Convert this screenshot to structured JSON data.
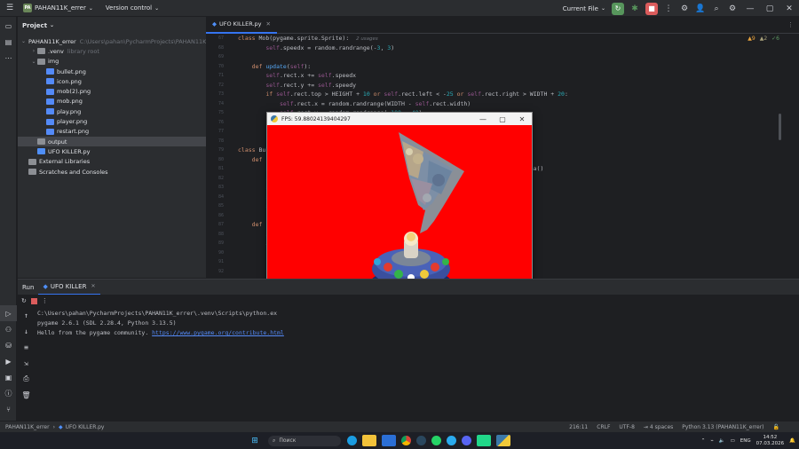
{
  "titlebar": {
    "menu_icon": "hamburger-icon",
    "project_badge": "PA",
    "project_name": "PAHAN11K_errer",
    "vcs_label": "Version control",
    "run_config": "Current File",
    "colors": {
      "run_green": "#57965c",
      "stop_red": "#db5c5c"
    }
  },
  "project_panel": {
    "title": "Project",
    "tree": [
      {
        "label": "PAHAN11K_errer",
        "hint": "C:\\Users\\pahan\\PycharmProjects\\PAHAN11K_errer",
        "level": 0,
        "icon": "folder-icon",
        "expanded": true
      },
      {
        "label": ".venv",
        "hint": "library root",
        "level": 1,
        "icon": "folder-icon",
        "expanded": false
      },
      {
        "label": "img",
        "hint": "",
        "level": 1,
        "icon": "folder-icon",
        "expanded": true
      },
      {
        "label": "bullet.png",
        "hint": "",
        "level": 2,
        "icon": "image-file-icon"
      },
      {
        "label": "icon.png",
        "hint": "",
        "level": 2,
        "icon": "image-file-icon"
      },
      {
        "label": "mob(2).png",
        "hint": "",
        "level": 2,
        "icon": "image-file-icon"
      },
      {
        "label": "mob.png",
        "hint": "",
        "level": 2,
        "icon": "image-file-icon"
      },
      {
        "label": "play.png",
        "hint": "",
        "level": 2,
        "icon": "image-file-icon"
      },
      {
        "label": "player.png",
        "hint": "",
        "level": 2,
        "icon": "image-file-icon"
      },
      {
        "label": "restart.png",
        "hint": "",
        "level": 2,
        "icon": "image-file-icon"
      },
      {
        "label": "output",
        "hint": "",
        "level": 1,
        "icon": "folder-icon",
        "selected": true
      },
      {
        "label": "UFO KILLER.py",
        "hint": "",
        "level": 1,
        "icon": "python-file-icon"
      },
      {
        "label": "External Libraries",
        "hint": "",
        "level": 0,
        "icon": "library-icon"
      },
      {
        "label": "Scratches and Consoles",
        "hint": "",
        "level": 0,
        "icon": "scratches-icon"
      }
    ]
  },
  "editor": {
    "tab_label": "UFO KILLER.py",
    "inspections": {
      "warnings": "9",
      "weak_warnings": "2",
      "typos": "6"
    },
    "lines": [
      {
        "n": "67",
        "html": "<span class='kw'>class</span> Mob(pygame.sprite.Sprite):  <span class='hint'>2 usages</span>"
      },
      {
        "n": "68",
        "html": "        <span class='sf'>self</span>.speedx = random.randrange(-<span class='num'>3</span>, <span class='num'>3</span>)"
      },
      {
        "n": "69",
        "html": ""
      },
      {
        "n": "70",
        "html": "    <span class='kw'>def</span> <span class='fn'>update</span>(<span class='sf'>self</span>):"
      },
      {
        "n": "71",
        "html": "        <span class='sf'>self</span>.rect.x += <span class='sf'>self</span>.speedx"
      },
      {
        "n": "72",
        "html": "        <span class='sf'>self</span>.rect.y += <span class='sf'>self</span>.speedy"
      },
      {
        "n": "73",
        "html": "        <span class='kw'>if</span> <span class='sf'>self</span>.rect.top &gt; HEIGHT + <span class='num'>10</span> <span class='kw'>or</span> <span class='sf'>self</span>.rect.left &lt; -<span class='num'>25</span> <span class='kw'>or</span> <span class='sf'>self</span>.rect.right &gt; WIDTH + <span class='num'>20</span>:"
      },
      {
        "n": "74",
        "html": "            <span class='sf'>self</span>.rect.x = random.randrange(WIDTH - <span class='sf'>self</span>.rect.width)"
      },
      {
        "n": "75",
        "html": "            <span class='sf'>self</span>.rect.y = random.randrange(-<span class='num'>100</span>, -<span class='num'>40</span>)"
      },
      {
        "n": "76",
        "html": ""
      },
      {
        "n": "77",
        "html": ""
      },
      {
        "n": "78",
        "html": ""
      },
      {
        "n": "79",
        "html": "<span class='kw'>class</span> Bul"
      },
      {
        "n": "80",
        "html": "    <span class='kw'>def</span>"
      },
      {
        "n": "81",
        "html": "        s                                                                          pha()"
      },
      {
        "n": "82",
        "html": "        s"
      },
      {
        "n": "83",
        "html": "        s"
      },
      {
        "n": "84",
        "html": "        s"
      },
      {
        "n": "85",
        "html": "        s"
      },
      {
        "n": "86",
        "html": ""
      },
      {
        "n": "87",
        "html": "    <span class='kw'>def</span>"
      },
      {
        "n": "88",
        "html": "        s"
      },
      {
        "n": "89",
        "html": "        i"
      },
      {
        "n": "90",
        "html": ""
      },
      {
        "n": "91",
        "html": ""
      },
      {
        "n": "92",
        "html": ""
      }
    ]
  },
  "run_panel": {
    "tab_run": "Run",
    "tab_config": "UFO KILLER",
    "output": [
      "C:\\Users\\pahan\\PycharmProjects\\PAHAN11K_errer\\.venv\\Scripts\\python.ex",
      "pygame 2.6.1 (SDL 2.28.4, Python 3.13.5)",
      "Hello from the pygame community. "
    ],
    "link": "https://www.pygame.org/contribute.html"
  },
  "statusbar": {
    "breadcrumb_project": "PAHAN11K_errer",
    "breadcrumb_file": "UFO KILLER.py",
    "position": "216:11",
    "line_sep": "CRLF",
    "encoding": "UTF-8",
    "indent": "4 spaces",
    "interpreter": "Python 3.13 (PAHAN11K_errer)"
  },
  "game_window": {
    "title": "FPS: 59.88024139404297",
    "background": "#ff0000"
  },
  "taskbar": {
    "search_placeholder": "Поиск",
    "lang": "ENG",
    "time": "14:52",
    "date": "07.03.2026"
  }
}
